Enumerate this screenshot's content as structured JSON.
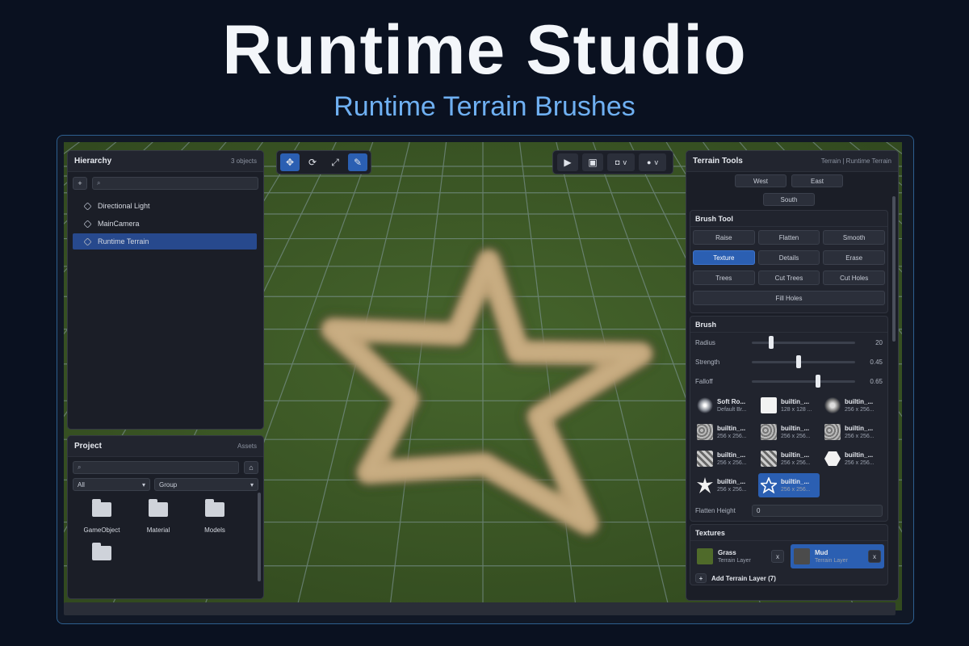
{
  "hero": {
    "title": "Runtime Studio",
    "subtitle": "Runtime Terrain Brushes"
  },
  "hierarchy": {
    "title": "Hierarchy",
    "count": "3 objects",
    "add_label": "+",
    "search_placeholder": "",
    "items": [
      "Directional Light",
      "MainCamera",
      "Runtime Terrain"
    ],
    "selected": "Runtime Terrain"
  },
  "project": {
    "title": "Project",
    "subtitle": "Assets",
    "filter_all": "All",
    "filter_group": "Group",
    "folders": [
      "GameObject",
      "Material",
      "Models",
      ""
    ]
  },
  "toolbar": {
    "tools": [
      "move-icon",
      "rotate-icon",
      "scale-icon",
      "terrain-brush-icon"
    ],
    "active_tools": [
      "move-icon",
      "terrain-brush-icon"
    ],
    "play_controls": [
      "play-icon",
      "save-icon",
      "camera-view-icon",
      "sphere-icon"
    ],
    "chevron": "v"
  },
  "terrain_tools": {
    "title": "Terrain Tools",
    "breadcrumb": "Terrain | Runtime Terrain",
    "neighbors": {
      "west": "West",
      "east": "East",
      "south": "South"
    },
    "brush_tool": {
      "title": "Brush Tool",
      "row1": [
        "Raise",
        "Flatten",
        "Smooth"
      ],
      "row2": [
        "Texture",
        "Details",
        "Erase"
      ],
      "row3": [
        "Trees",
        "Cut Trees",
        "Cut Holes"
      ],
      "row4": [
        "Fill Holes"
      ],
      "active": "Texture"
    },
    "brush": {
      "title": "Brush",
      "radius": {
        "label": "Radius",
        "value": "20",
        "fraction": 0.17
      },
      "strength": {
        "label": "Strength",
        "value": "0.45",
        "fraction": 0.45
      },
      "falloff": {
        "label": "Falloff",
        "value": "0.65",
        "fraction": 0.65
      },
      "presets": [
        {
          "name": "Soft Ro...",
          "size": "Default Br...",
          "icon": "soft-round-brush-icon"
        },
        {
          "name": "builtin_...",
          "size": "128 x 128 ...",
          "icon": "square-brush-icon"
        },
        {
          "name": "builtin_...",
          "size": "256 x 256...",
          "icon": "soft-noise-brush-icon"
        },
        {
          "name": "builtin_...",
          "size": "256 x 256...",
          "icon": "noise-brush-icon"
        },
        {
          "name": "builtin_...",
          "size": "256 x 256...",
          "icon": "noise-brush-icon"
        },
        {
          "name": "builtin_...",
          "size": "256 x 256...",
          "icon": "noise-brush-icon"
        },
        {
          "name": "builtin_...",
          "size": "256 x 256...",
          "icon": "cloud-brush-icon"
        },
        {
          "name": "builtin_...",
          "size": "256 x 256...",
          "icon": "cloud-brush-icon"
        },
        {
          "name": "builtin_...",
          "size": "256 x 256...",
          "icon": "hexagon-brush-icon"
        },
        {
          "name": "builtin_...",
          "size": "256 x 256...",
          "icon": "burst-brush-icon"
        },
        {
          "name": "builtin_...",
          "size": "256 x 256...",
          "icon": "star-brush-icon"
        }
      ],
      "active_preset": 10,
      "flatten_label": "Flatten Height",
      "flatten_value": "0"
    },
    "textures": {
      "title": "Textures",
      "layers": [
        {
          "name": "Grass",
          "sub": "Terrain Layer",
          "color": "#4f6a2a",
          "remove": "x"
        },
        {
          "name": "Mud",
          "sub": "Terrain Layer",
          "color": "#4b4b4b",
          "remove": "x"
        }
      ],
      "active_layer": "Mud",
      "add_label": "Add Terrain Layer (7)"
    }
  },
  "colors": {
    "accent": "#2b5fb2",
    "grass": "#3f5a26",
    "path": "#bfa378",
    "frame": "#2d5f8f"
  }
}
